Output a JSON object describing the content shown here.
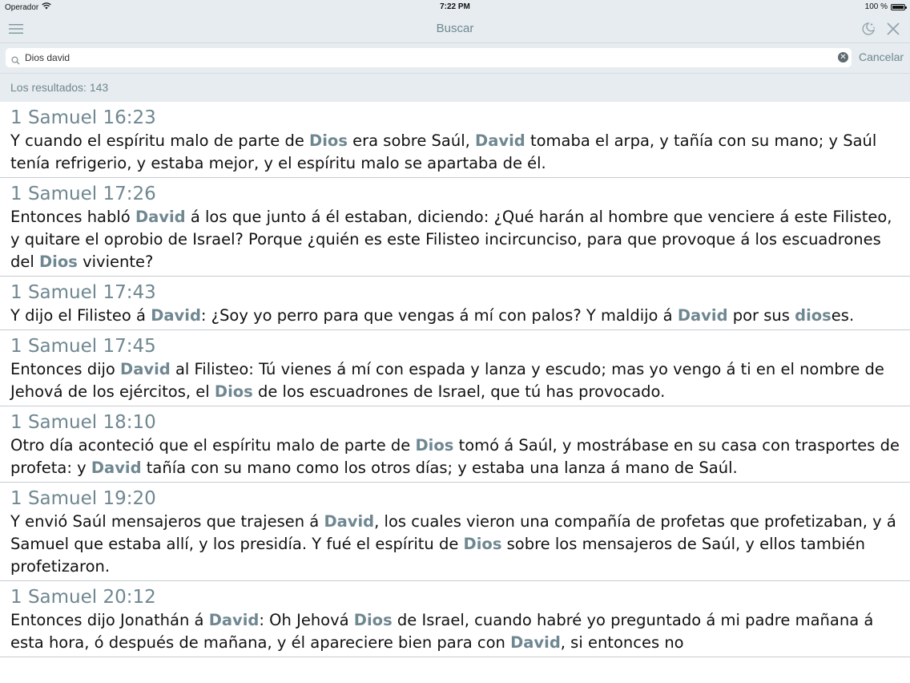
{
  "status_bar": {
    "carrier": "Operador",
    "time": "7:22 PM",
    "battery": "100 %",
    "wifi_icon": "wifi-icon",
    "battery_icon": "battery-icon"
  },
  "nav": {
    "title": "Buscar",
    "menu_icon": "hamburger-menu-icon",
    "night_icon": "moon-stars-icon",
    "close_icon": "close-icon"
  },
  "search": {
    "value": "Dios david",
    "placeholder": "",
    "cancel_label": "Cancelar",
    "search_icon": "search-icon",
    "clear_icon": "clear-icon"
  },
  "results": {
    "count_label": "Los resultados: 143",
    "highlight_color": "#6f8791",
    "items": [
      {
        "ref": "1 Samuel 16:23",
        "segments": [
          {
            "t": "Y cuando el espíritu malo de parte de ",
            "h": false
          },
          {
            "t": "Dios",
            "h": true
          },
          {
            "t": " era sobre Saúl, ",
            "h": false
          },
          {
            "t": "David",
            "h": true
          },
          {
            "t": " tomaba el arpa, y tañía con su mano; y Saúl tenía refrigerio, y estaba mejor, y el espíritu malo se apartaba de él.",
            "h": false
          }
        ]
      },
      {
        "ref": "1 Samuel 17:26",
        "segments": [
          {
            "t": "Entonces habló ",
            "h": false
          },
          {
            "t": "David",
            "h": true
          },
          {
            "t": " á los que junto á él estaban, diciendo: ¿Qué harán al hombre que venciere á este Filisteo, y quitare el oprobio de Israel? Porque ¿quién es este Filisteo incircunciso, para que provoque á los escuadrones del ",
            "h": false
          },
          {
            "t": "Dios",
            "h": true
          },
          {
            "t": " viviente?",
            "h": false
          }
        ]
      },
      {
        "ref": "1 Samuel 17:43",
        "segments": [
          {
            "t": "Y dijo el Filisteo á ",
            "h": false
          },
          {
            "t": "David",
            "h": true
          },
          {
            "t": ": ¿Soy yo perro para que vengas á mí con palos? Y maldijo á ",
            "h": false
          },
          {
            "t": "David",
            "h": true
          },
          {
            "t": " por sus ",
            "h": false
          },
          {
            "t": "dios",
            "h": true
          },
          {
            "t": "es.",
            "h": false
          }
        ]
      },
      {
        "ref": "1 Samuel 17:45",
        "segments": [
          {
            "t": "Entonces dijo ",
            "h": false
          },
          {
            "t": "David",
            "h": true
          },
          {
            "t": " al Filisteo: Tú vienes á mí con espada y lanza y escudo; mas yo vengo á ti en el nombre de Jehová de los ejércitos, el ",
            "h": false
          },
          {
            "t": "Dios",
            "h": true
          },
          {
            "t": " de los escuadrones de Israel, que tú has provocado.",
            "h": false
          }
        ]
      },
      {
        "ref": "1 Samuel 18:10",
        "segments": [
          {
            "t": "Otro día aconteció que el espíritu malo de parte de ",
            "h": false
          },
          {
            "t": "Dios",
            "h": true
          },
          {
            "t": " tomó á Saúl, y mostrábase en su casa con trasportes de profeta: y ",
            "h": false
          },
          {
            "t": "David",
            "h": true
          },
          {
            "t": " tañía con su mano como los otros días; y estaba una lanza á mano de Saúl.",
            "h": false
          }
        ]
      },
      {
        "ref": "1 Samuel 19:20",
        "segments": [
          {
            "t": "Y envió Saúl mensajeros que trajesen á ",
            "h": false
          },
          {
            "t": "David",
            "h": true
          },
          {
            "t": ", los cuales vieron una compañía de profetas que profetizaban, y á Samuel que estaba allí, y los presidía. Y fué el espíritu de ",
            "h": false
          },
          {
            "t": "Dios",
            "h": true
          },
          {
            "t": " sobre los mensajeros de Saúl, y ellos también profetizaron.",
            "h": false
          }
        ]
      },
      {
        "ref": "1 Samuel 20:12",
        "segments": [
          {
            "t": "Entonces dijo Jonathán á ",
            "h": false
          },
          {
            "t": "David",
            "h": true
          },
          {
            "t": ": Oh Jehová ",
            "h": false
          },
          {
            "t": "Dios",
            "h": true
          },
          {
            "t": " de Israel, cuando habré yo preguntado á mi padre mañana á esta hora, ó después de mañana, y él apareciere bien para con ",
            "h": false
          },
          {
            "t": "David",
            "h": true
          },
          {
            "t": ", si entonces no",
            "h": false
          }
        ]
      }
    ]
  }
}
